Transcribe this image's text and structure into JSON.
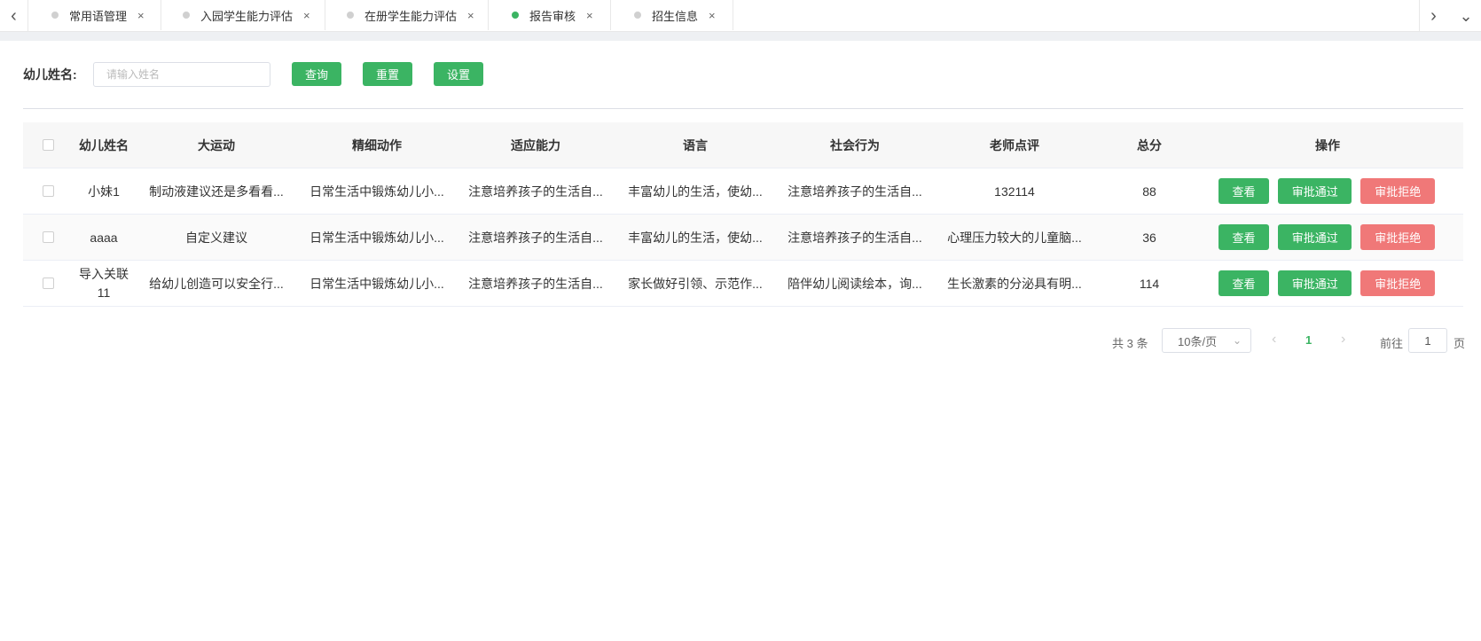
{
  "tabs": {
    "items": [
      {
        "label": "常用语管理",
        "active": false
      },
      {
        "label": "入园学生能力评估",
        "active": false
      },
      {
        "label": "在册学生能力评估",
        "active": false
      },
      {
        "label": "报告审核",
        "active": true
      },
      {
        "label": "招生信息",
        "active": false
      }
    ],
    "close_glyph": "×",
    "left_arrow": "‹",
    "right_arrow": "›",
    "down_arrow": "⌄"
  },
  "filter": {
    "label": "幼儿姓名:",
    "placeholder": "请输入姓名",
    "value": "",
    "query_label": "查询",
    "reset_label": "重置",
    "settings_label": "设置"
  },
  "table": {
    "headers": [
      "幼儿姓名",
      "大运动",
      "精细动作",
      "适应能力",
      "语言",
      "社会行为",
      "老师点评",
      "总分",
      "操作"
    ],
    "rows": [
      {
        "name": "小妹1",
        "gross_motor": "制动液建议还是多看看...",
        "fine_motor": "日常生活中锻炼幼儿小...",
        "adaptive": "注意培养孩子的生活自...",
        "language": "丰富幼儿的生活，使幼...",
        "social": "注意培养孩子的生活自...",
        "teacher_comment": "132114",
        "total": "88"
      },
      {
        "name": "aaaa",
        "gross_motor": "自定义建议",
        "fine_motor": "日常生活中锻炼幼儿小...",
        "adaptive": "注意培养孩子的生活自...",
        "language": "丰富幼儿的生活，使幼...",
        "social": "注意培养孩子的生活自...",
        "teacher_comment": "心理压力较大的儿童脑...",
        "total": "36"
      },
      {
        "name": "导入关联11",
        "gross_motor": "给幼儿创造可以安全行...",
        "fine_motor": "日常生活中锻炼幼儿小...",
        "adaptive": "注意培养孩子的生活自...",
        "language": "家长做好引领、示范作...",
        "social": "陪伴幼儿阅读绘本，询...",
        "teacher_comment": "生长激素的分泌具有明...",
        "total": "114"
      }
    ],
    "actions": {
      "view": "查看",
      "approve": "审批通过",
      "reject": "审批拒绝"
    }
  },
  "pagination": {
    "total": "共 3 条",
    "page_size": "10条/页",
    "current_page": "1",
    "goto_label": "前往",
    "goto_value": "1",
    "page_suffix": "页"
  },
  "colors": {
    "accent": "#3bb463",
    "danger": "#f07878"
  }
}
